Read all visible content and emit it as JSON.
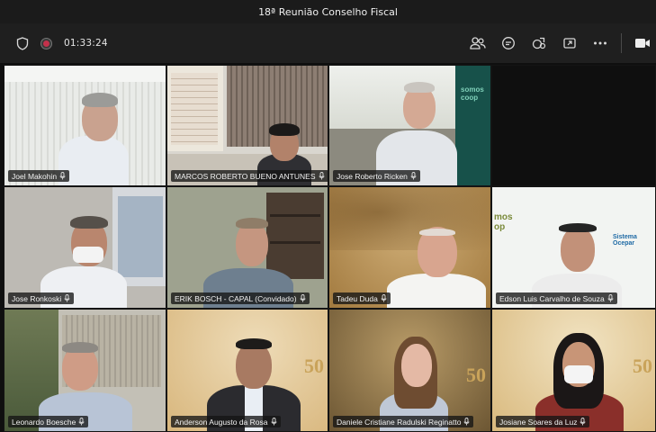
{
  "window": {
    "title": "18ª Reunião Conselho Fiscal"
  },
  "toolbar": {
    "timer": "01:33:24",
    "icons": [
      "shield-icon",
      "recording-icon",
      "people-icon",
      "chat-icon",
      "reactions-icon",
      "share-tray-icon",
      "more-icon",
      "camera-icon"
    ],
    "recording_color": "#c4314b"
  },
  "participants": [
    {
      "name": "Joel Makohin"
    },
    {
      "name": "MARCOS ROBERTO BUENO ANTUNES"
    },
    {
      "name": "Jose Roberto Ricken"
    },
    {
      "name": "Jose Ronkoski"
    },
    {
      "name": "ERIK BOSCH - CAPAL (Convidado)"
    },
    {
      "name": "Tadeu Duda"
    },
    {
      "name": "Edson Luis Carvalho de Souza"
    },
    {
      "name": "Leonardo Boesche"
    },
    {
      "name": "Anderson Augusto da Rosa"
    },
    {
      "name": "Daniele Cristiane Radulski Reginatto"
    },
    {
      "name": "Josiane Soares da Luz"
    }
  ]
}
